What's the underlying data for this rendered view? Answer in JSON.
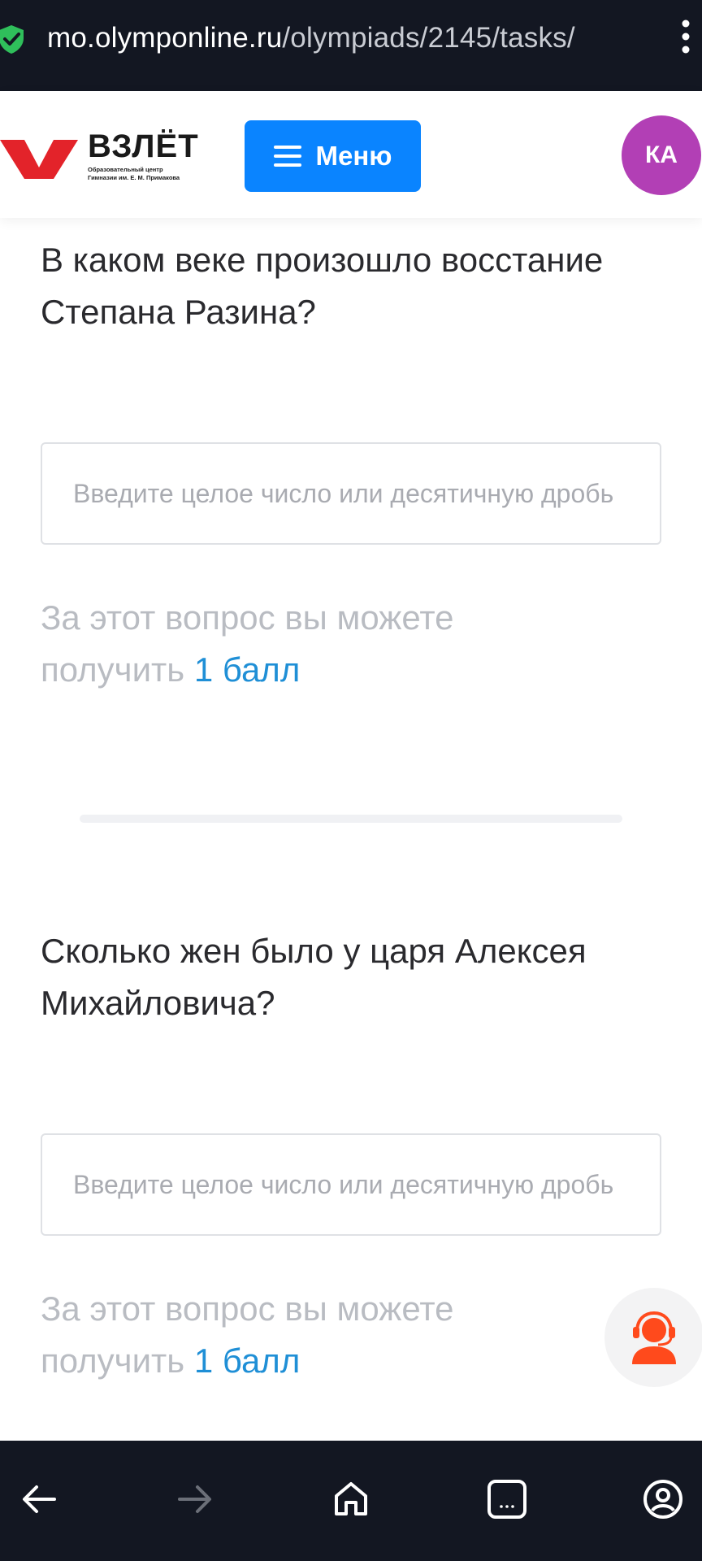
{
  "browser": {
    "url_host": "mo.olymponline.ru",
    "url_path": "/olympiads/2145/tasks/"
  },
  "header": {
    "logo_text": "ВЗЛЁТ",
    "logo_subtitle_line1": "Образовательный центр",
    "logo_subtitle_line2": "Гимназии им. Е. М. Примакова",
    "menu_label": "Меню",
    "avatar_initials": "КА"
  },
  "questions": [
    {
      "text": "В каком веке произошло восстание Степана Разина?",
      "placeholder": "Введите целое число или десятичную дробь",
      "value": "",
      "points_prefix": "За этот вопрос вы можете получить",
      "points_value": "1 балл"
    },
    {
      "text": "Сколько жен было у царя Алексея Михайловича?",
      "placeholder": "Введите целое число или десятичную дробь",
      "value": "",
      "points_prefix": "За этот вопрос вы можете получить",
      "points_value": "1 балл"
    }
  ],
  "colors": {
    "menu_button": "#0a84ff",
    "avatar": "#b23fb5",
    "points_value": "#1f8fd6",
    "support_icon": "#ff4a1c",
    "logo_mark": "#e3232a"
  },
  "icons": {
    "lock": "shield-check-icon",
    "kebab": "more-vertical-icon",
    "menu": "hamburger-icon",
    "support": "headset-support-icon",
    "nav": [
      "back-arrow-icon",
      "forward-arrow-icon",
      "home-icon",
      "tabs-icon",
      "profile-icon"
    ]
  }
}
